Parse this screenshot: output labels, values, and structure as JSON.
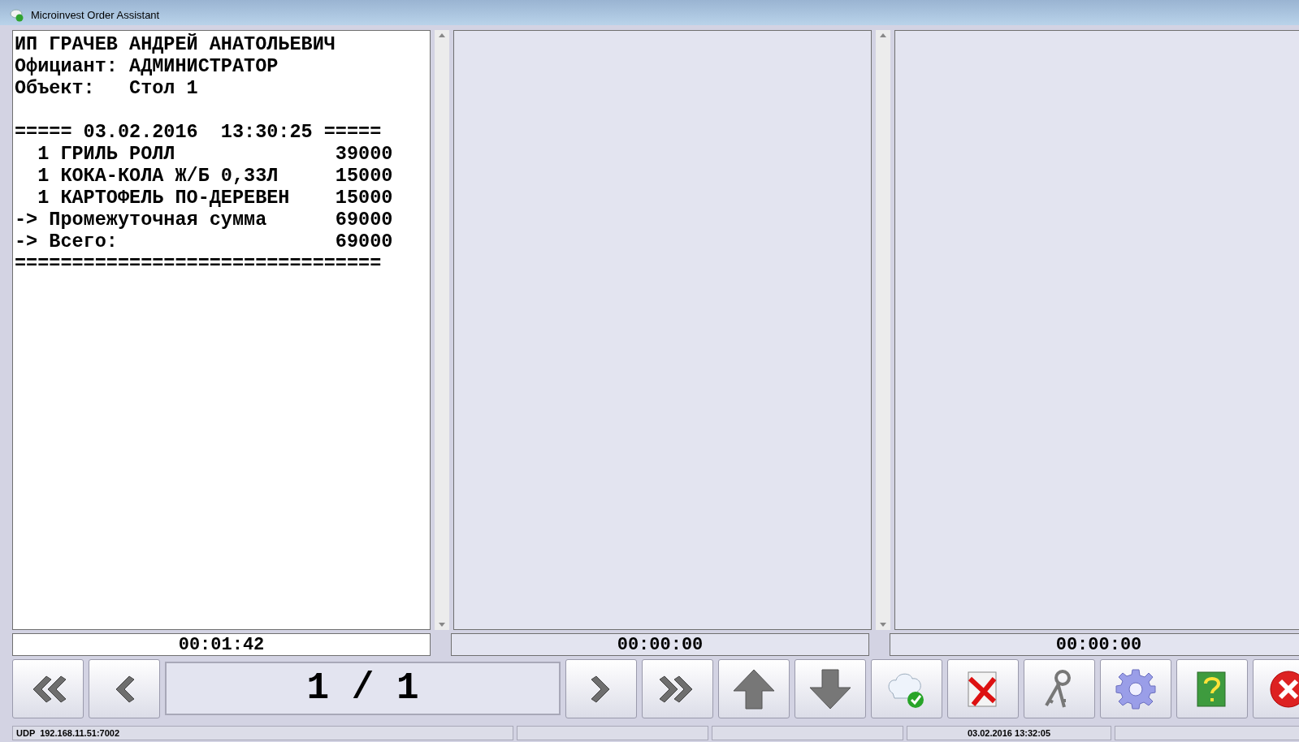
{
  "window": {
    "title": "Microinvest Order Assistant"
  },
  "orders": [
    {
      "selected": true,
      "scrollbar": true,
      "header": [
        "ИП ГРАЧЕВ АНДРЕЙ АНАТОЛЬЕВИЧ",
        "Официант: АДМИНИСТРАТОР",
        "Объект:   Стол 1"
      ],
      "lines": [
        "===== 03.02.2016  13:30:25 =====",
        "  1 ГРИЛЬ РОЛЛ              39000",
        "  1 КОКА-КОЛА Ж/Б 0,33Л     15000",
        "  1 КАРТОФЕЛЬ ПО-ДЕРЕВЕН    15000",
        "-> Промежуточная сумма      69000",
        "-> Всего:                   69000",
        "================================"
      ],
      "timer": "00:01:42"
    },
    {
      "selected": false,
      "scrollbar": true,
      "timer": "00:00:00"
    },
    {
      "selected": false,
      "scrollbar": false,
      "timer": "00:00:00"
    }
  ],
  "toolbar": [
    {
      "kind": "first"
    },
    {
      "kind": "prev"
    },
    {
      "kind": "page",
      "text": "1 / 1"
    },
    {
      "kind": "next"
    },
    {
      "kind": "last"
    },
    {
      "kind": "up"
    },
    {
      "kind": "down"
    },
    {
      "kind": "ready"
    },
    {
      "kind": "cancel"
    },
    {
      "kind": "keys"
    },
    {
      "kind": "settings"
    },
    {
      "kind": "help"
    },
    {
      "kind": "close"
    }
  ],
  "status_bar": {
    "connection": "UDP  192.168.11.51:7002",
    "clock": "03.02.2016 13:32:05"
  }
}
